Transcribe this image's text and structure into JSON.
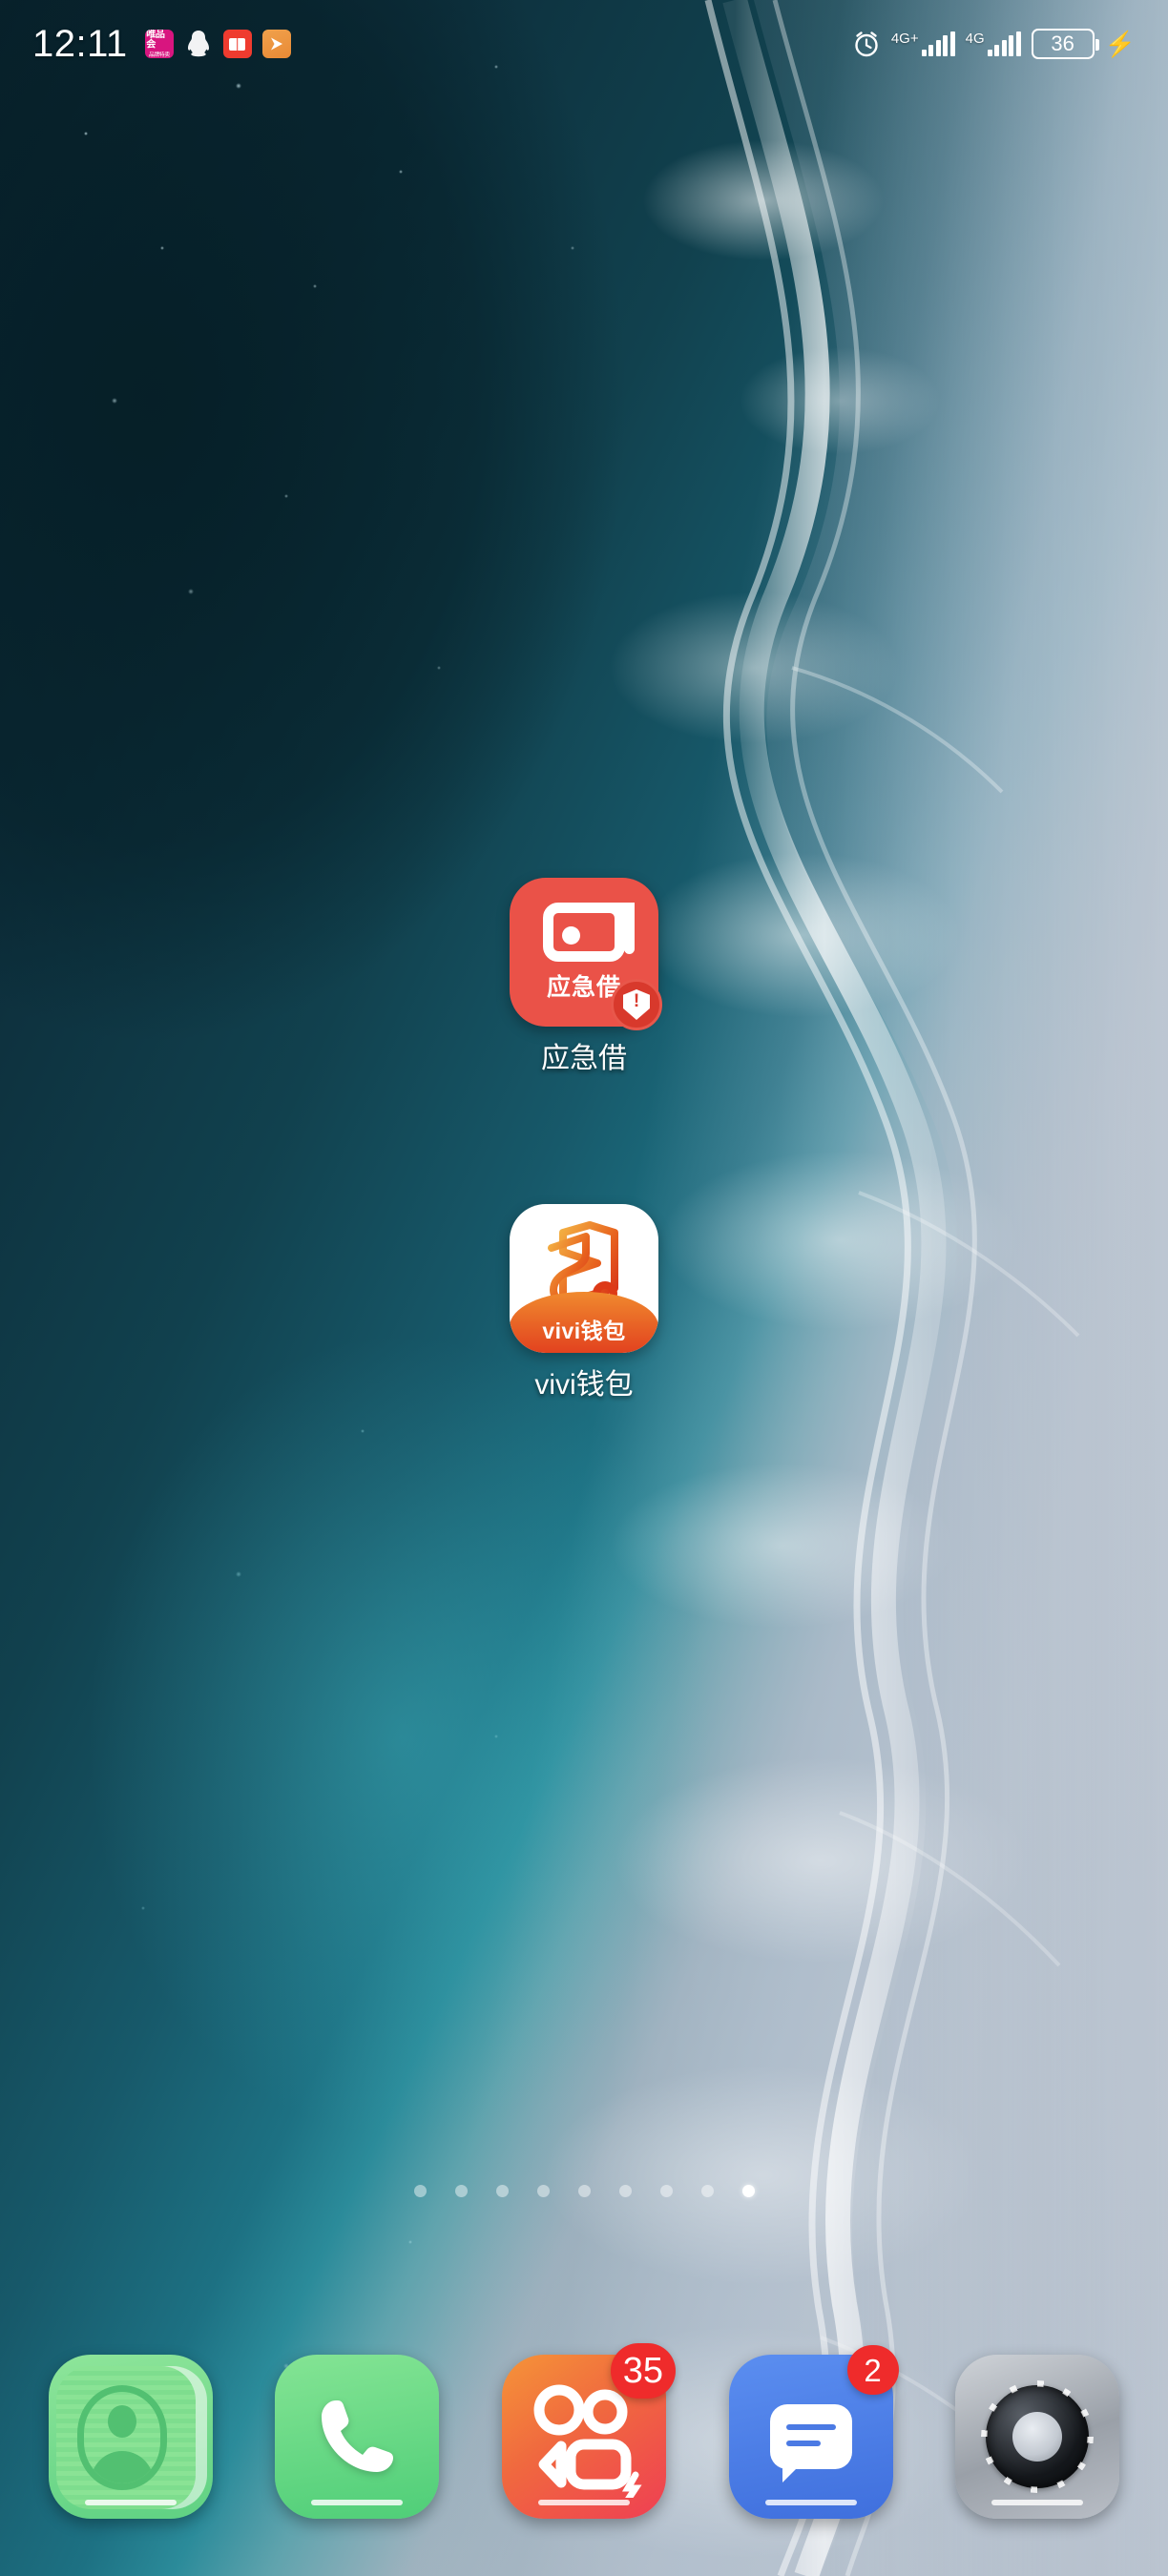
{
  "status_bar": {
    "time": "12:11",
    "notification_icons": [
      {
        "name": "vipshop-icon",
        "line1": "唯品会",
        "line2": "品牌特卖",
        "color": "#d8157f"
      },
      {
        "name": "qq-icon",
        "label": "QQ",
        "color": "#ffffff"
      },
      {
        "name": "book-reader-icon",
        "label": "阅读",
        "color": "#ef3b2f"
      },
      {
        "name": "video-play-icon",
        "label": "视频",
        "color": "#ed8f3c"
      }
    ],
    "alarm": "alarm-clock-icon",
    "sim1_network": "4G+",
    "sim1_bars": 5,
    "sim2_network": "4G",
    "sim2_bars": 5,
    "battery_percent": "36",
    "charging": true
  },
  "home": {
    "apps": [
      {
        "name": "yingjijie",
        "label": "应急借",
        "icon_text": "应急借",
        "icon_color": "#ea5248",
        "badge": "warning"
      },
      {
        "name": "vivi-wallet",
        "label": "vivi钱包",
        "icon_text": "vivi钱包",
        "icon_color": "#ffffff",
        "accent_color": "#e8571f"
      }
    ],
    "page_dots": {
      "count": 9,
      "active_index": 8
    }
  },
  "dock": {
    "items": [
      {
        "name": "contacts",
        "label": "联系人",
        "color": "#5fd183",
        "badge": null
      },
      {
        "name": "phone",
        "label": "电话",
        "color": "#4fce78",
        "badge": null
      },
      {
        "name": "kuaishou",
        "label": "快手",
        "color": "#ef3f53",
        "badge": "35"
      },
      {
        "name": "messages",
        "label": "信息",
        "color": "#3f6fdd",
        "badge": "2"
      },
      {
        "name": "camera",
        "label": "相机",
        "color": "#9aa0a8",
        "badge": null
      }
    ]
  }
}
